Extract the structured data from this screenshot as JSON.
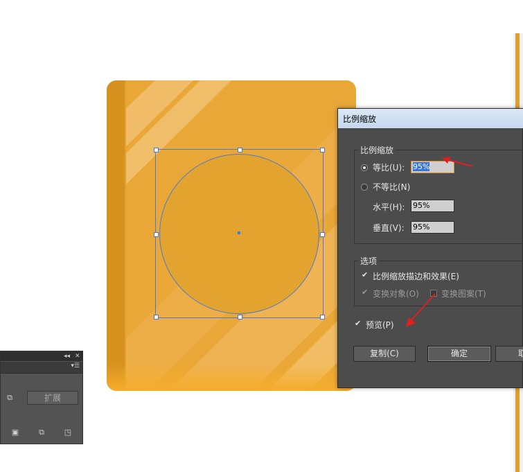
{
  "colors": {
    "book": "#e9a737",
    "spine": "#d6921f",
    "circle": "#e3a42f",
    "selection": "#4a78d8",
    "dialog_bg": "#4c4c4c",
    "annotation_arrow": "#e02020"
  },
  "dialog": {
    "title": "比例缩放",
    "scale_group": {
      "label": "比例缩放",
      "uniform_label": "等比(U):",
      "uniform_value": "95%",
      "uniform_selected": true,
      "nonuniform_label": "不等比(N)",
      "horizontal_label": "水平(H):",
      "horizontal_value": "95%",
      "vertical_label": "垂直(V):",
      "vertical_value": "95%"
    },
    "options_group": {
      "label": "选项",
      "scale_strokes_label": "比例缩放描边和效果(E)",
      "scale_strokes_checked": true,
      "transform_objects_label": "变换对象(O)",
      "transform_objects_checked": true,
      "transform_patterns_label": "变换图案(T)",
      "transform_patterns_checked": false
    },
    "preview_label": "预览(P)",
    "preview_checked": true,
    "copy_button": "复制(C)",
    "ok_button": "确定",
    "cancel_button": "取"
  },
  "panel": {
    "expand_button": "扩展",
    "collapse_icon": "double-chevron-left-icon",
    "close_icon": "close-icon",
    "menu_icon": "panel-menu-icon"
  }
}
